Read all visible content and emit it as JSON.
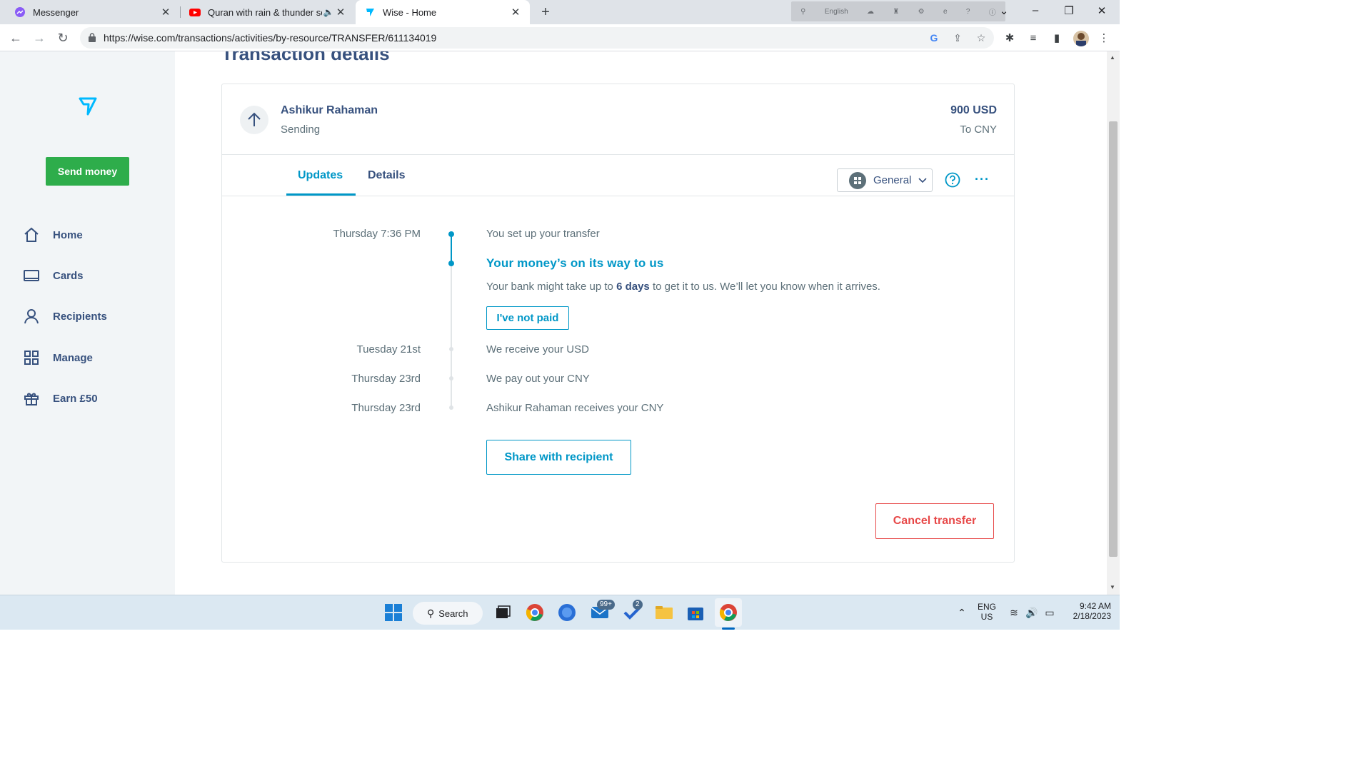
{
  "browser": {
    "tabs": [
      {
        "title": "Messenger",
        "icon": "messenger-icon"
      },
      {
        "title": "Quran with rain & thunder sc",
        "icon": "youtube-icon",
        "audio": "speaker-icon"
      },
      {
        "title": "Wise - Home",
        "icon": "wise-icon",
        "active": true
      }
    ],
    "url": "https://wise.com/transactions/activities/by-resource/TRANSFER/611134019",
    "ext_language": "English"
  },
  "sidebar": {
    "send_money": "Send money",
    "items": [
      {
        "label": "Home",
        "icon": "home-icon"
      },
      {
        "label": "Cards",
        "icon": "card-icon"
      },
      {
        "label": "Recipients",
        "icon": "recipients-icon"
      },
      {
        "label": "Manage",
        "icon": "grid-icon"
      },
      {
        "label": "Earn £50",
        "icon": "gift-icon"
      }
    ]
  },
  "page": {
    "title": "Transaction details",
    "recipient_name": "Ashikur Rahaman",
    "status": "Sending",
    "amount": "900 USD",
    "to_currency": "To CNY",
    "tabs": [
      "Updates",
      "Details"
    ],
    "dropdown": "General",
    "timeline": [
      {
        "date": "Thursday 7:36 PM",
        "text": "You set up your transfer"
      },
      {
        "date": "Tuesday 21st",
        "text": "We receive your USD"
      },
      {
        "date": "Thursday 23rd",
        "text": "We pay out your CNY"
      },
      {
        "date": "Thursday 23rd",
        "text": "Ashikur Rahaman receives your CNY"
      }
    ],
    "current_step": {
      "headline": "Your money’s on its way to us",
      "note_prefix": "Your bank might take up to ",
      "note_bold": "6 days",
      "note_suffix": " to get it to us. We’ll let you know when it arrives.",
      "button": "I've not paid"
    },
    "share_button": "Share with recipient",
    "cancel_button": "Cancel transfer"
  },
  "taskbar": {
    "search": "Search",
    "mail_badge": "99+",
    "todo_badge": "2",
    "lang_top": "ENG",
    "lang_bottom": "US",
    "time": "9:42 AM",
    "date": "2/18/2023"
  },
  "colors": {
    "accent": "#0097c7",
    "navy": "#37517e",
    "green": "#2ead4b",
    "danger": "#e74848"
  }
}
